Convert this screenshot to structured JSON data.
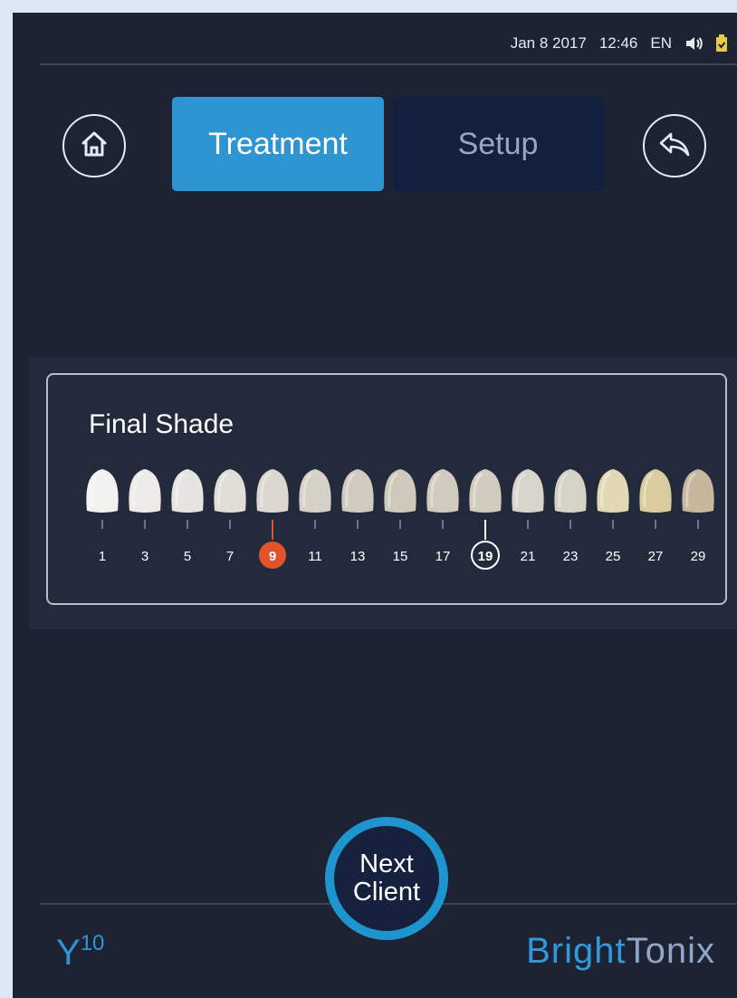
{
  "status_bar": {
    "date": "Jan 8 2017",
    "time": "12:46",
    "language": "EN",
    "icons": [
      "speaker-icon",
      "battery-icon"
    ]
  },
  "nav": {
    "home_icon": "home-icon",
    "back_icon": "back-arrow-icon",
    "tabs": [
      {
        "label": "Treatment",
        "active": true
      },
      {
        "label": "Setup",
        "active": false
      }
    ]
  },
  "shade": {
    "title": "Final Shade",
    "scale": [
      "1",
      "3",
      "5",
      "7",
      "9",
      "11",
      "13",
      "15",
      "17",
      "19",
      "21",
      "23",
      "25",
      "27",
      "29"
    ],
    "colors": [
      "#f2f2f0",
      "#ecebe8",
      "#e7e5e1",
      "#e1ded8",
      "#dcd8d0",
      "#d6d1c7",
      "#d1cbbf",
      "#cfc9bb",
      "#d0cbbd",
      "#d2ccbe",
      "#d8d5cc",
      "#d5d2c6",
      "#e1d9b5",
      "#d9cda0",
      "#c8b79d"
    ],
    "selected_start": "9",
    "selected_current": "19"
  },
  "footer": {
    "next_line1": "Next",
    "next_line2": "Client",
    "model_letter": "Y",
    "model_number": "10",
    "brand_part1": "Bright",
    "brand_part2": "Tonix"
  },
  "colors": {
    "background": "#1d2333",
    "accent": "#2e95d3",
    "marker_start": "#e1532a",
    "inactive_tab": "#121f3e"
  }
}
